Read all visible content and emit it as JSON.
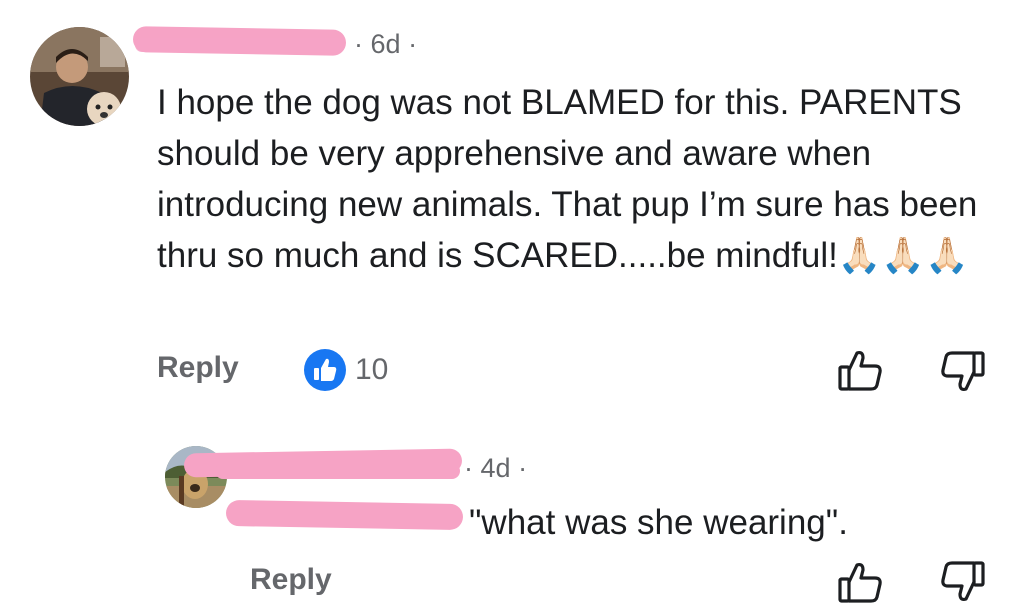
{
  "comment": {
    "time": "6d",
    "separator": "·",
    "text": "I hope the dog was not BLAMED for this. PARENTS should be very apprehensive and aware when introducing new animals. That pup I’m sure has been thru so much and is SCARED.....be mindful!🙏🏻🙏🏻🙏🏻",
    "reply_label": "Reply",
    "like_count": "10"
  },
  "reply": {
    "time": "4d",
    "separator": "·",
    "text": "\"what was she wearing\".",
    "reply_label": "Reply"
  },
  "colors": {
    "like_blue": "#1877f2",
    "meta_gray": "#65676b",
    "redaction_pink": "#f6a3c5"
  },
  "icons": [
    "thumbs-up-icon",
    "thumbs-down-icon",
    "like-reaction-icon"
  ]
}
